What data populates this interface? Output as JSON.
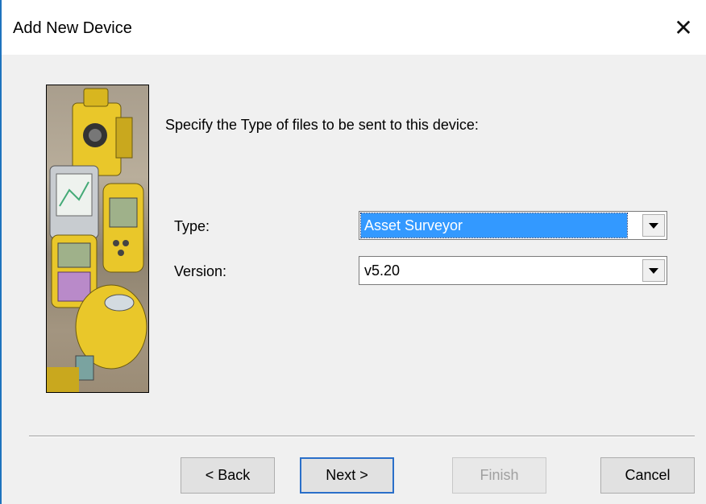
{
  "window": {
    "title": "Add New Device",
    "close_glyph": "✕"
  },
  "main": {
    "instruction": "Specify the Type of files to be sent to this device:",
    "type_label": "Type:",
    "type_value": "Asset Surveyor",
    "version_label": "Version:",
    "version_value": "v5.20"
  },
  "buttons": {
    "back": "< Back",
    "next": "Next >",
    "finish": "Finish",
    "cancel": "Cancel"
  },
  "colors": {
    "selection": "#3399ff",
    "device_yellow": "#e9c72a",
    "window_bg": "#f0f0f0"
  }
}
